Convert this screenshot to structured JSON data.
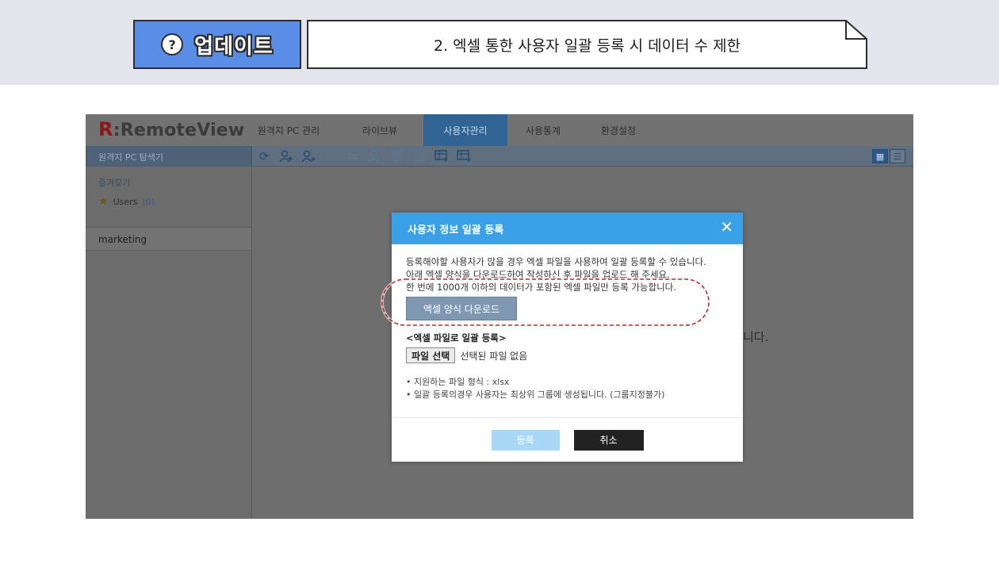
{
  "banner": {
    "badge_icon": "?",
    "badge_label": "업데이트",
    "title": "2. 엑셀 통한 사용자 일괄 등록 시 데이터 수 제한"
  },
  "app": {
    "logo_mark": "R",
    "logo_colon": ":",
    "logo_text": "RemoteView",
    "nav": [
      "원격지 PC 관리",
      "라이브뷰",
      "사용자관리",
      "사용통계",
      "환경설정"
    ],
    "active_nav": "사용자관리",
    "explorer_label": "원격지 PC 탐색기",
    "toolbar_icons": [
      "refresh-icon",
      "add-user-group-icon",
      "add-user-icon",
      "favorite-icon",
      "move-icon",
      "edit-user-icon",
      "delete-icon",
      "memo-icon",
      "excel-import-icon",
      "excel-export-icon"
    ],
    "view_toggle": [
      "grid-view-icon",
      "list-view-icon"
    ],
    "favorites_title": "즐겨찾기",
    "fav_users_label": "Users",
    "fav_users_count": "(0)",
    "group_name": "marketing",
    "main_message_tail": "니다."
  },
  "modal": {
    "title": "사용자 정보 일괄 등록",
    "close_glyph": "✕",
    "desc": [
      "등록해야할 사용자가 많을 경우 엑셀 파일을 사용하여 일괄 등록할 수 있습니다.",
      "아래 엑셀 양식을 다운로드하여 작성하신 후 파일을 업로드 해 주세요.",
      "한 번에 1000개 이하의 데이터가 포함된 엑셀 파일만 등록 가능합니다."
    ],
    "download_button": "엑셀 양식 다운로드",
    "section_title": "<엑셀 파일로 일괄 등록>",
    "file_button": "파일 선택",
    "file_status": "선택된 파일 없음",
    "notes": [
      "• 지원하는 파일 형식 : xlsx",
      "• 일괄 등록의경우 사용자는 최상위 그룹에 생성됩니다. (그룹지정불가)"
    ],
    "register_button": "등록",
    "cancel_button": "취소"
  },
  "colors": {
    "badge": "#5a8de6",
    "modal_header": "#3aa0e8",
    "highlight": "#c0282d",
    "active_nav": "#2f6494"
  }
}
